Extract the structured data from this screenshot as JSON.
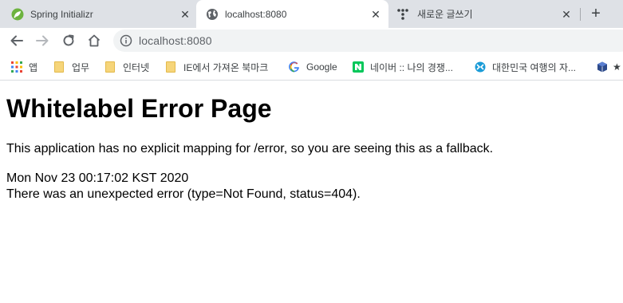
{
  "tabs": [
    {
      "title": "Spring Initializr",
      "favicon": "spring-icon",
      "active": false
    },
    {
      "title": "localhost:8080",
      "favicon": "globe-icon",
      "active": true
    },
    {
      "title": "새로운 글쓰기",
      "favicon": "tistory-icon",
      "active": false
    }
  ],
  "toolbar": {
    "url": "localhost:8080"
  },
  "bookmarks": [
    {
      "label": "앱",
      "icon": "apps-grid-icon"
    },
    {
      "label": "업무",
      "icon": "folder-icon"
    },
    {
      "label": "인터넷",
      "icon": "folder-icon"
    },
    {
      "label": "IE에서 가져온 북마크",
      "icon": "folder-icon"
    },
    {
      "label": "Google",
      "icon": "google-icon"
    },
    {
      "label": "네이버 :: 나의 경쟁...",
      "icon": "naver-icon"
    },
    {
      "label": "대한민국 여행의 자...",
      "icon": "travel-icon"
    }
  ],
  "page": {
    "heading": "Whitelabel Error Page",
    "message": "This application has no explicit mapping for /error, so you are seeing this as a fallback.",
    "timestamp": "Mon Nov 23 00:17:02 KST 2020",
    "error": "There was an unexpected error (type=Not Found, status=404)."
  },
  "colors": {
    "tabstrip": "#dee1e6",
    "omnibox": "#f1f3f4",
    "spring_green": "#6db33f",
    "naver_green": "#03c75a",
    "travel_blue": "#1a9bd7"
  }
}
